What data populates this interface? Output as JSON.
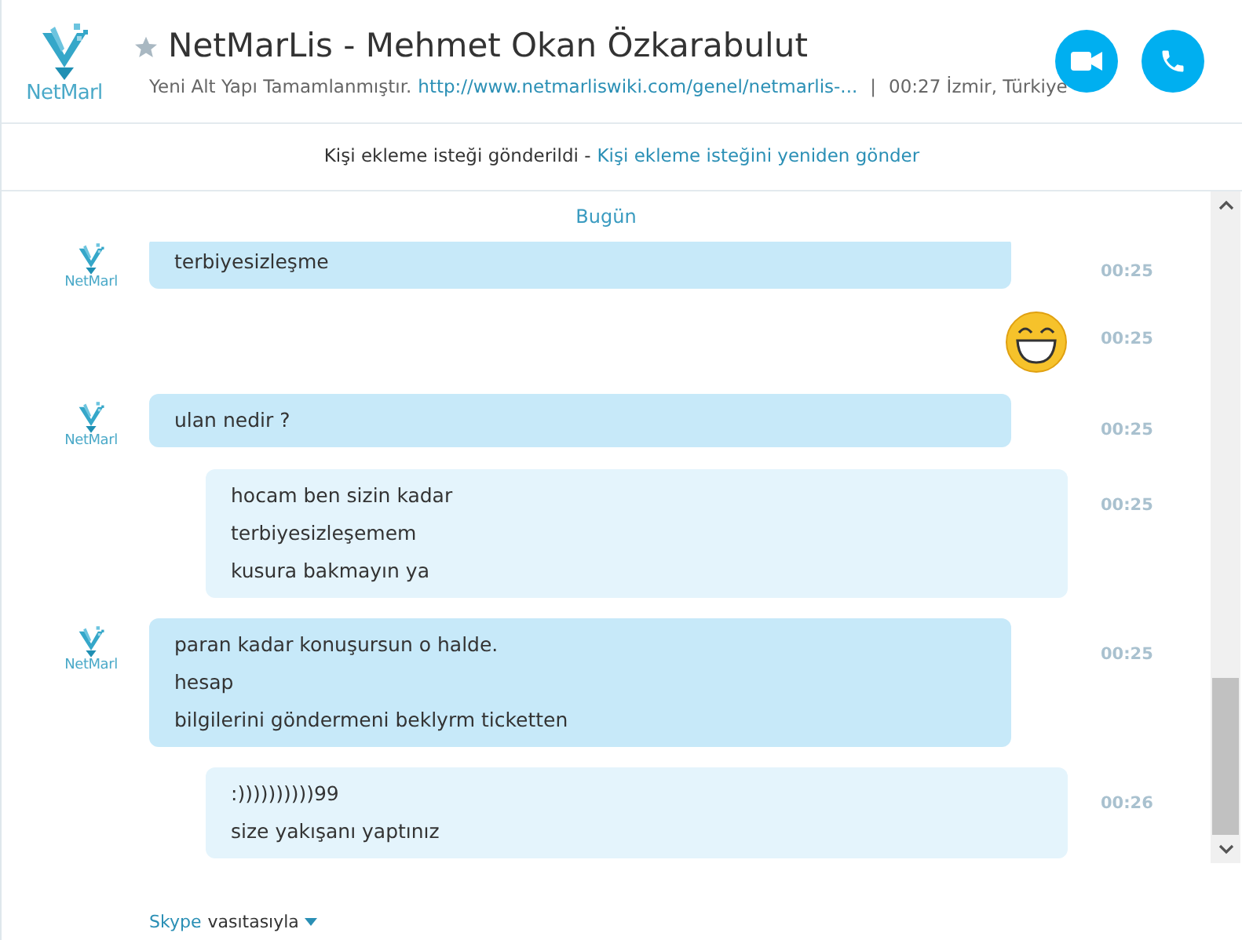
{
  "header": {
    "logo_text": "NetMarl",
    "title": "NetMarLis - Mehmet Okan Özkarabulut",
    "mood": "Yeni Alt Yapı Tamamlanmıştır.",
    "mood_link": "http://www.netmarliswiki.com/genel/netmarlis-...",
    "separator": "|",
    "local_time": "00:27 İzmir, Türkiye"
  },
  "notice": {
    "text": "Kişi ekleme isteği gönderildi -",
    "link": "Kişi ekleme isteğini yeniden gönder"
  },
  "day_label": "Bugün",
  "messages": [
    {
      "kind": "incoming",
      "avatar_text": "NetMarl",
      "lines": [
        "terbiyesizleşme"
      ],
      "time": "00:25"
    },
    {
      "kind": "emoji",
      "time": "00:25"
    },
    {
      "kind": "incoming",
      "avatar_text": "NetMarl",
      "lines": [
        "ulan nedir ?"
      ],
      "time": "00:25"
    },
    {
      "kind": "outgoing",
      "lines": [
        "hocam ben sizin kadar",
        "terbiyesizleşemem",
        "kusura bakmayın ya"
      ],
      "time": "00:25"
    },
    {
      "kind": "incoming",
      "avatar_text": "NetMarl",
      "lines": [
        "paran kadar konuşursun o halde.",
        "hesap",
        "bilgilerini göndermeni beklyrm ticketten"
      ],
      "time": "00:25"
    },
    {
      "kind": "outgoing",
      "lines": [
        ":))))))))))99",
        "size yakışanı yaptınız"
      ],
      "time": "00:26"
    }
  ],
  "footer": {
    "service": "Skype",
    "text": "vasıtasıyla"
  }
}
